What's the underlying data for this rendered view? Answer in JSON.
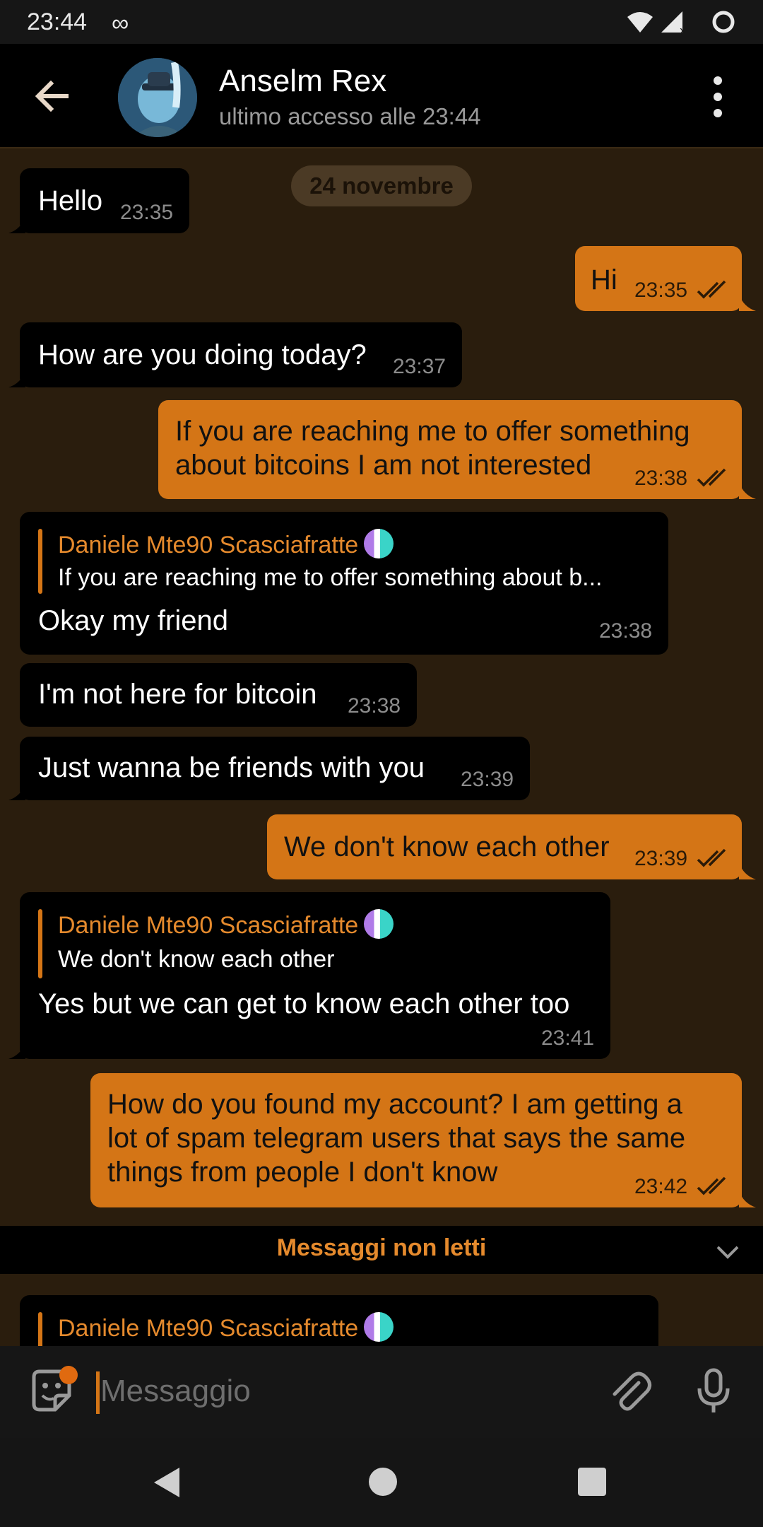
{
  "status_bar": {
    "time": "23:44",
    "infinity_icon": "∞"
  },
  "header": {
    "contact_name": "Anselm Rex",
    "contact_status": "ultimo accesso alle 23:44"
  },
  "chat": {
    "date_label": "24 novembre",
    "reply_author": "Daniele Mte90 Scasciafratte",
    "messages": [
      {
        "dir": "in",
        "text": "Hello",
        "time": "23:35"
      },
      {
        "dir": "out",
        "text": "Hi",
        "time": "23:35",
        "read": true
      },
      {
        "dir": "in",
        "text": "How are you doing today?",
        "time": "23:37"
      },
      {
        "dir": "out",
        "text": "If you are reaching me to offer something\nabout bitcoins I am not interested",
        "time": "23:38",
        "read": true
      },
      {
        "dir": "in",
        "reply_to": "If you are reaching me to offer something about b...",
        "text": "Okay my friend",
        "time": "23:38"
      },
      {
        "dir": "in",
        "text": "I'm not here for bitcoin",
        "time": "23:38"
      },
      {
        "dir": "in",
        "text": "Just wanna be friends with you",
        "time": "23:39"
      },
      {
        "dir": "out",
        "text": "We don't know each other",
        "time": "23:39",
        "read": true
      },
      {
        "dir": "in",
        "reply_to": "We don't know each other",
        "text": "Yes but we can get to know each other too",
        "time": "23:41"
      },
      {
        "dir": "out",
        "text": "How do you found my account? I am getting a\nlot of spam telegram users that says the same\nthings from people I don't know",
        "time": "23:42",
        "read": true
      }
    ],
    "unread_label": "Messaggi non letti"
  },
  "input": {
    "placeholder": "Messaggio",
    "value": ""
  },
  "colors": {
    "background": "#2a1d0d",
    "accent": "#d47516",
    "incoming_bubble": "#000000",
    "outgoing_bubble": "#d47516"
  },
  "icons": {
    "back": "arrow-left-icon",
    "menu": "more-vertical-icon",
    "sticker": "sticker-icon",
    "attach": "paperclip-icon",
    "mic": "microphone-icon",
    "read": "double-check-icon"
  }
}
